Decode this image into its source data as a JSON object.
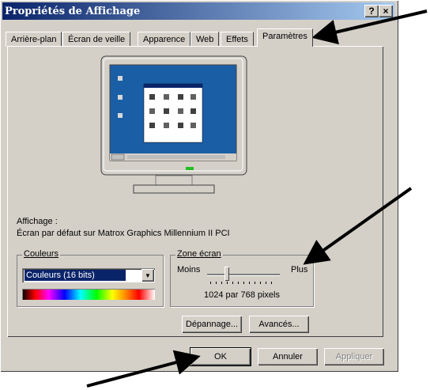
{
  "window": {
    "title": "Propriétés de Affichage",
    "help_label": "?",
    "close_label": "×"
  },
  "tabs": [
    {
      "label": "Arrière-plan"
    },
    {
      "label": "Écran de veille"
    },
    {
      "label": "Apparence"
    },
    {
      "label": "Web"
    },
    {
      "label": "Effets"
    },
    {
      "label": "Paramètres"
    }
  ],
  "display": {
    "label": "Affichage :",
    "device": "Écran par défaut sur Matrox Graphics Millennium II PCI"
  },
  "colors": {
    "group_label": "Couleurs",
    "selected": "Couleurs (16 bits)"
  },
  "screen_area": {
    "group_label": "Zone écran",
    "less": "Moins",
    "more": "Plus",
    "value": "1024 par 768 pixels"
  },
  "buttons": {
    "troubleshoot": "Dépannage...",
    "advanced": "Avancés...",
    "ok": "OK",
    "cancel": "Annuler",
    "apply": "Appliquer"
  }
}
